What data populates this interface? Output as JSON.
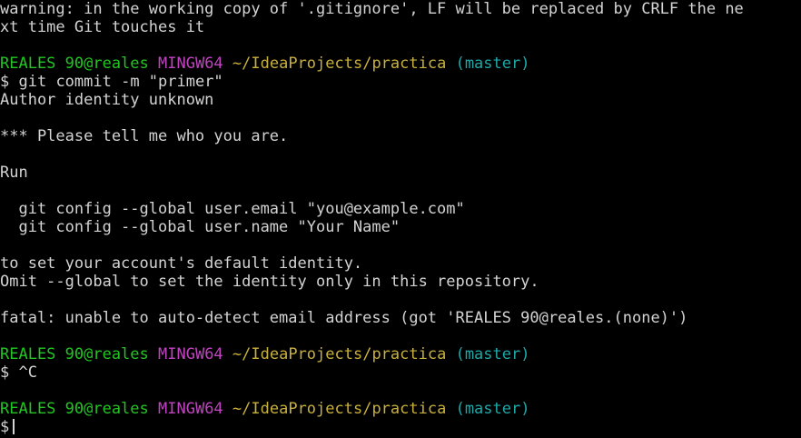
{
  "colors": {
    "background": "#000000",
    "text": "#d3d3d3",
    "user": "#22c522",
    "msystem": "#c044c0",
    "path": "#c8b03c",
    "branch": "#1fa8a8"
  },
  "warning": {
    "line1": "warning: in the working copy of '.gitignore', LF will be replaced by CRLF the ne",
    "line2": "xt time Git touches it"
  },
  "prompt": {
    "user": "REALES 90@reales",
    "msystem": "MINGW64",
    "path": "~/IdeaProjects/practica",
    "branch": "(master)",
    "symbol": "$"
  },
  "commands": {
    "first": "git commit -m \"primer\"",
    "second": "^C"
  },
  "output": {
    "author": "Author identity unknown",
    "please": "*** Please tell me who you are.",
    "run": "Run",
    "config_email": "  git config --global user.email \"you@example.com\"",
    "config_name": "  git config --global user.name \"Your Name\"",
    "set_default": "to set your account's default identity.",
    "omit": "Omit --global to set the identity only in this repository.",
    "fatal": "fatal: unable to auto-detect email address (got 'REALES 90@reales.(none)')"
  }
}
